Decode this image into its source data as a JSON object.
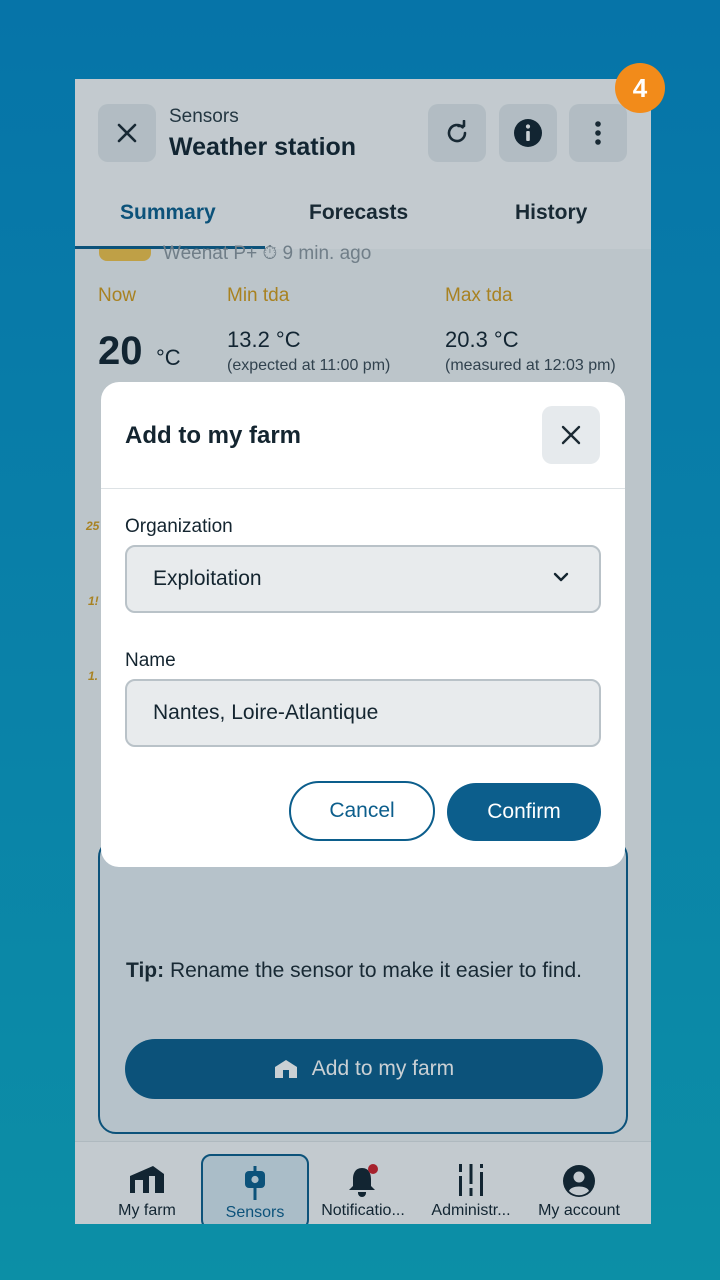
{
  "step_badge": "4",
  "header": {
    "subtitle": "Sensors",
    "title": "Weather station"
  },
  "tabs": [
    {
      "label": "Summary",
      "active": true
    },
    {
      "label": "Forecasts",
      "active": false
    },
    {
      "label": "History",
      "active": false
    }
  ],
  "summary": {
    "partial_text": "Weenat P+ ⏱ 9 min. ago",
    "now_label": "Now",
    "now_value": "20",
    "now_unit": "°C",
    "min_label": "Min tda",
    "min_value": "13.2 °C",
    "min_note": "(expected at 11:00 pm)",
    "max_label": "Max tda",
    "max_value": "20.3 °C",
    "max_note": "(measured at 12:03 pm)",
    "y_ticks": [
      "25",
      "1!",
      "1."
    ]
  },
  "tip": {
    "bold": "Tip:",
    "text": " Rename the sensor to make it easier to find.",
    "button_label": "Add to my farm"
  },
  "modal": {
    "title": "Add to my farm",
    "organization_label": "Organization",
    "organization_value": "Exploitation",
    "name_label": "Name",
    "name_value": "Nantes, Loire-Atlantique",
    "cancel_label": "Cancel",
    "confirm_label": "Confirm"
  },
  "bottom_nav": [
    {
      "label": "My farm",
      "icon": "barn-icon"
    },
    {
      "label": "Sensors",
      "icon": "sensor-icon",
      "active": true
    },
    {
      "label": "Notificatio...",
      "icon": "bell-icon"
    },
    {
      "label": "Administr...",
      "icon": "sliders-icon"
    },
    {
      "label": "My account",
      "icon": "account-icon"
    }
  ],
  "colors": {
    "primary": "#0c5e8c",
    "accent": "#f28b1a",
    "label_gold": "#d49b1a",
    "notification_dot": "#d11f2a"
  }
}
